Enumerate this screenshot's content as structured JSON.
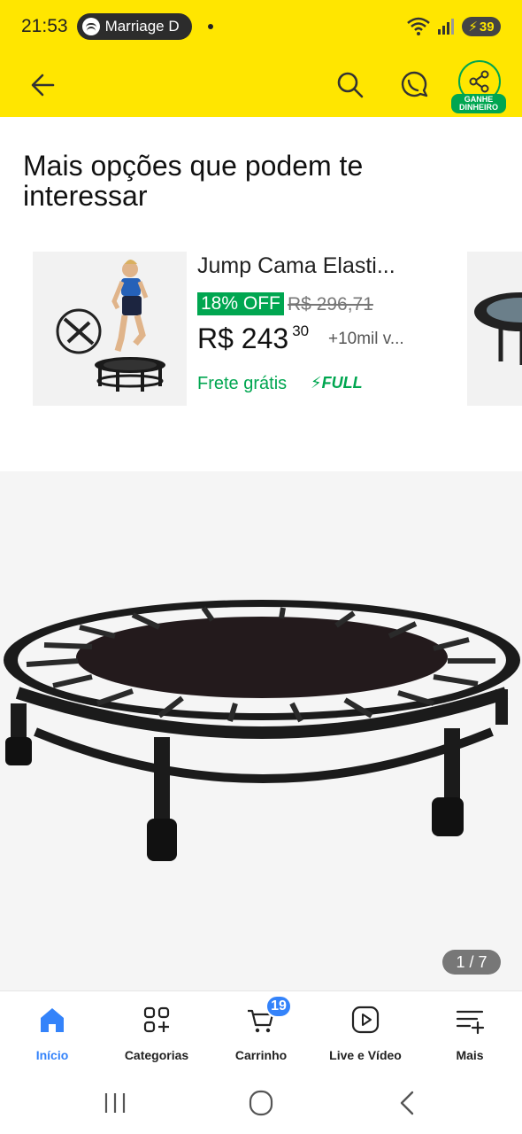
{
  "status_bar": {
    "time": "21:53",
    "media_app_label": "Marriage D",
    "battery_level": "39"
  },
  "header": {
    "share_label": "GANHE DINHEIRO"
  },
  "section": {
    "title": "Mais opções que podem te interessar"
  },
  "product_card": {
    "title": "Jump Cama Elasti...",
    "discount": "18% OFF",
    "old_price": "R$ 296,71",
    "price_main": "R$ 243",
    "price_cents": "30",
    "sold": "+10mil v...",
    "shipping": "Frete grátis",
    "full_label": "FULL"
  },
  "gallery": {
    "counter": "1 / 7"
  },
  "bottom_nav": {
    "items": [
      {
        "label": "Início",
        "icon": "home-icon",
        "active": true
      },
      {
        "label": "Categorias",
        "icon": "categories-icon"
      },
      {
        "label": "Carrinho",
        "icon": "cart-icon",
        "badge": "19"
      },
      {
        "label": "Live e Vídeo",
        "icon": "video-play-icon"
      },
      {
        "label": "Mais",
        "icon": "menu-plus-icon"
      }
    ]
  },
  "colors": {
    "brand_yellow": "#ffe600",
    "accent_blue": "#3483fa",
    "success_green": "#00a650"
  }
}
